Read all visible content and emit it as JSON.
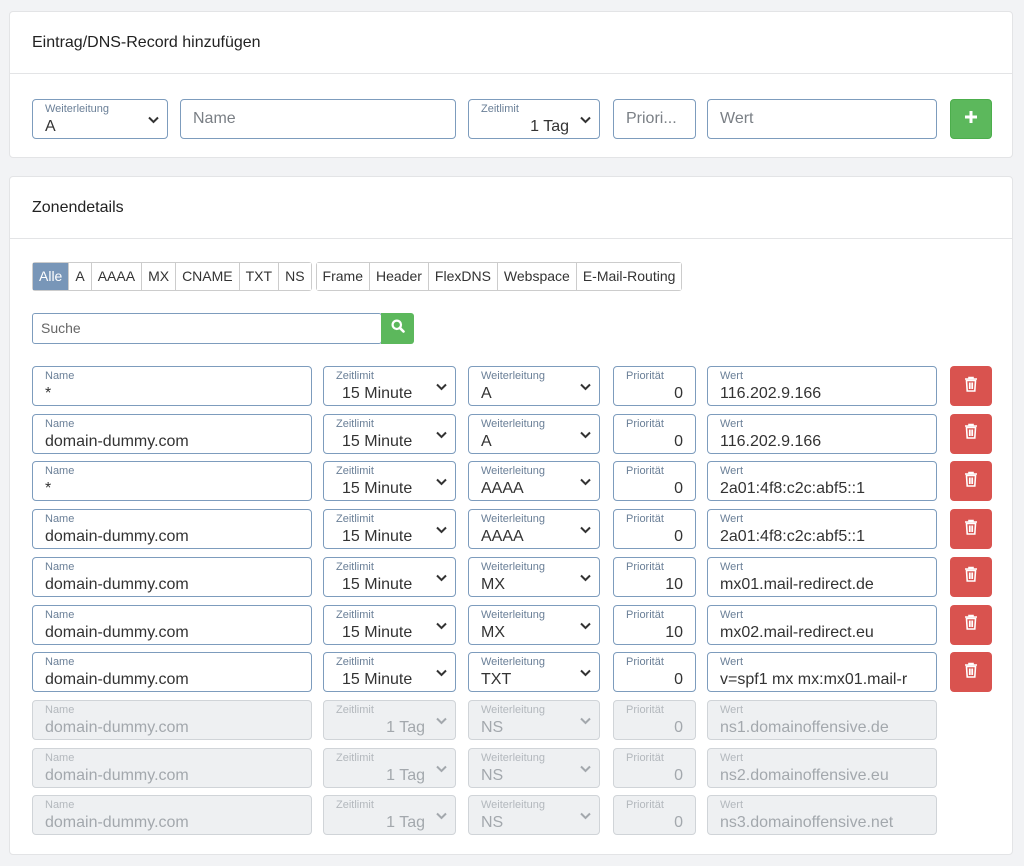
{
  "add_record": {
    "title": "Eintrag/DNS-Record hinzufügen",
    "type_label": "Weiterleitung",
    "type_value": "A",
    "name_placeholder": "Name",
    "ttl_label": "Zeitlimit",
    "ttl_value": "1 Tag",
    "priority_placeholder": "Priori...",
    "value_placeholder": "Wert",
    "add_button_icon": "plus-icon"
  },
  "zone": {
    "title": "Zonendetails",
    "tab_group_1": [
      "Alle",
      "A",
      "AAAA",
      "MX",
      "CNAME",
      "TXT",
      "NS"
    ],
    "tab_group_2": [
      "Frame",
      "Header",
      "FlexDNS",
      "Webspace",
      "E-Mail-Routing"
    ],
    "active_tab": "Alle",
    "search_placeholder": "Suche",
    "labels": {
      "name": "Name",
      "ttl": "Zeitlimit",
      "type": "Weiterleitung",
      "priority": "Priorität",
      "value": "Wert"
    },
    "records": [
      {
        "name": "*",
        "ttl": "15 Minute",
        "type": "A",
        "priority": "0",
        "value": "116.202.9.166",
        "editable": true
      },
      {
        "name": "domain-dummy.com",
        "ttl": "15 Minute",
        "type": "A",
        "priority": "0",
        "value": "116.202.9.166",
        "editable": true
      },
      {
        "name": "*",
        "ttl": "15 Minute",
        "type": "AAAA",
        "priority": "0",
        "value": "2a01:4f8:c2c:abf5::1",
        "editable": true
      },
      {
        "name": "domain-dummy.com",
        "ttl": "15 Minute",
        "type": "AAAA",
        "priority": "0",
        "value": "2a01:4f8:c2c:abf5::1",
        "editable": true
      },
      {
        "name": "domain-dummy.com",
        "ttl": "15 Minute",
        "type": "MX",
        "priority": "10",
        "value": "mx01.mail-redirect.de",
        "editable": true
      },
      {
        "name": "domain-dummy.com",
        "ttl": "15 Minute",
        "type": "MX",
        "priority": "10",
        "value": "mx02.mail-redirect.eu",
        "editable": true
      },
      {
        "name": "domain-dummy.com",
        "ttl": "15 Minute",
        "type": "TXT",
        "priority": "0",
        "value": "v=spf1 mx mx:mx01.mail-r",
        "editable": true
      },
      {
        "name": "domain-dummy.com",
        "ttl": "1 Tag",
        "type": "NS",
        "priority": "0",
        "value": "ns1.domainoffensive.de",
        "editable": false
      },
      {
        "name": "domain-dummy.com",
        "ttl": "1 Tag",
        "type": "NS",
        "priority": "0",
        "value": "ns2.domainoffensive.eu",
        "editable": false
      },
      {
        "name": "domain-dummy.com",
        "ttl": "1 Tag",
        "type": "NS",
        "priority": "0",
        "value": "ns3.domainoffensive.net",
        "editable": false
      }
    ]
  },
  "colors": {
    "accent_green": "#5cb85c",
    "danger_red": "#d9534f",
    "active_tab": "#7896b8",
    "field_border": "#7d9cbd"
  }
}
